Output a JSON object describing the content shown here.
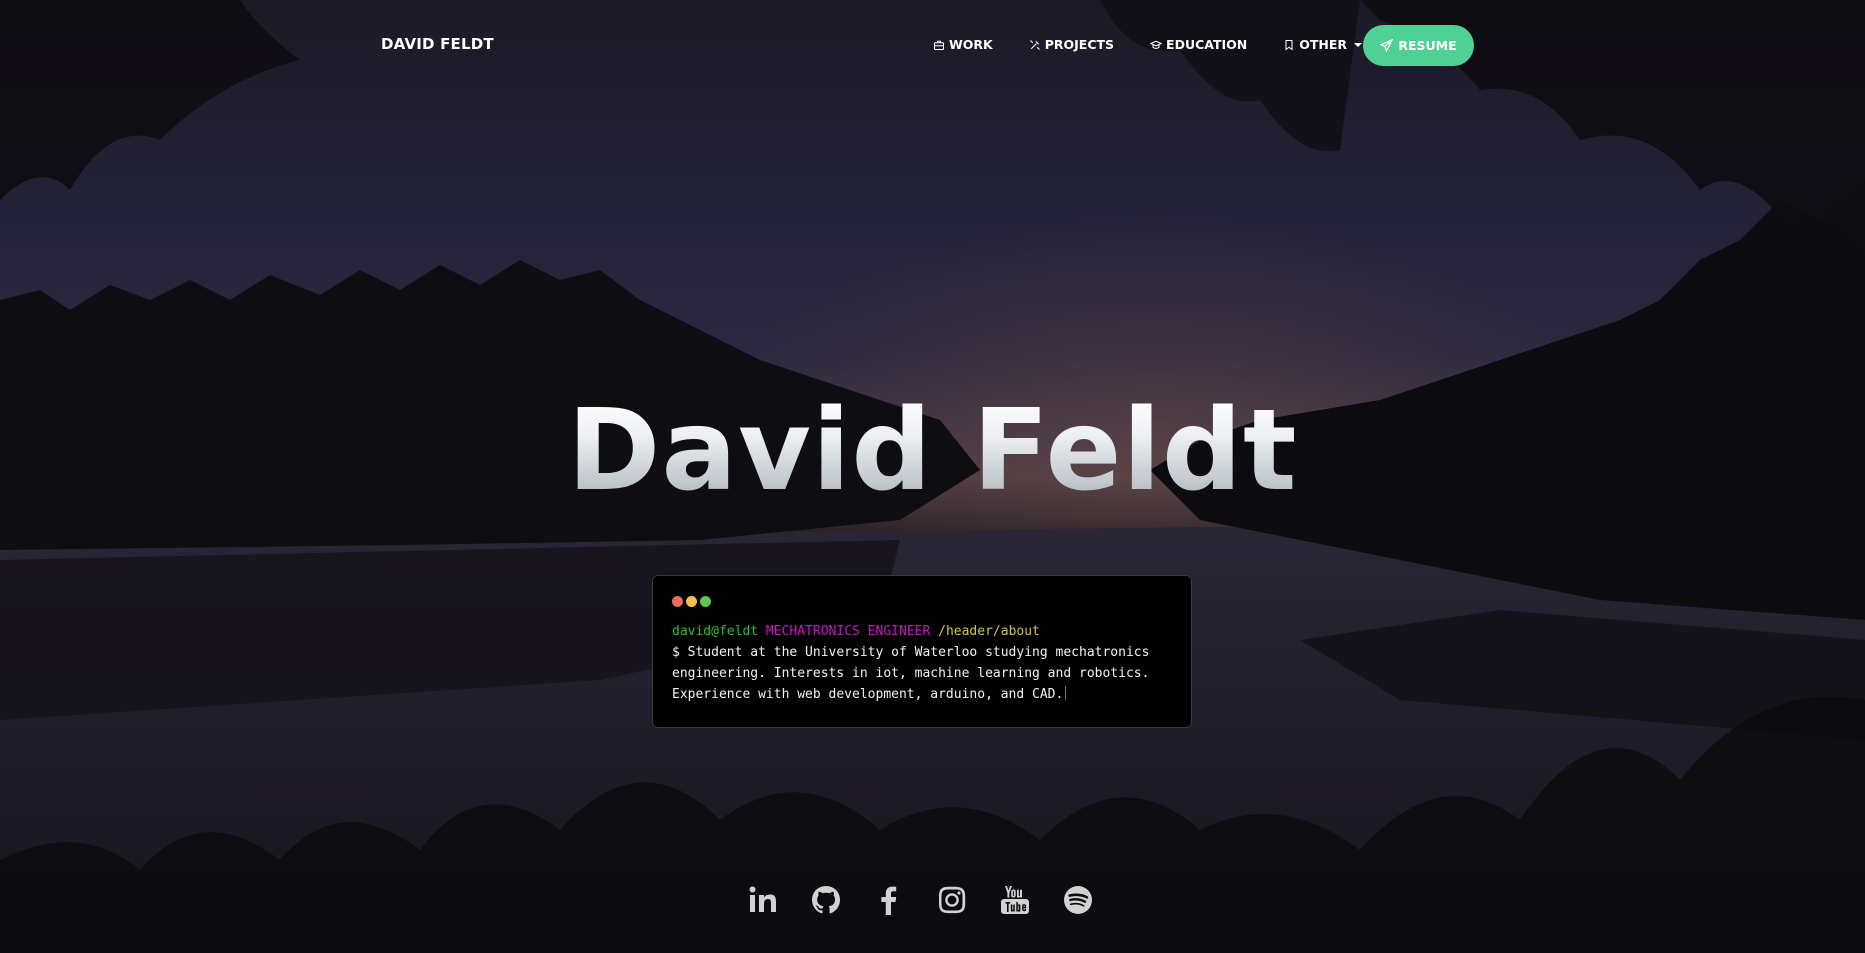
{
  "nav": {
    "brand": "DAVID FELDT",
    "links": [
      {
        "label": "WORK",
        "icon": "briefcase-icon"
      },
      {
        "label": "PROJECTS",
        "icon": "tools-icon"
      },
      {
        "label": "EDUCATION",
        "icon": "graduation-cap-icon"
      },
      {
        "label": "OTHER",
        "icon": "bookmark-icon"
      }
    ],
    "resume_label": "RESUME",
    "resume_icon": "paper-plane-icon",
    "accent_color": "#4fd195"
  },
  "hero": {
    "title": "David Feldt"
  },
  "terminal": {
    "user": "david@feldt",
    "role": "MECHATRONICS ENGINEER",
    "path": "/header/about",
    "line1": "$ Student at the University of Waterloo studying mechatronics",
    "line2": "engineering. Interests in iot, machine learning and robotics.",
    "line3": "Experience with web development, arduino, and CAD.",
    "dot_colors": [
      "#ec6a5e",
      "#f4bf4f",
      "#61c554"
    ]
  },
  "social": [
    {
      "name": "linkedin-icon"
    },
    {
      "name": "github-icon"
    },
    {
      "name": "facebook-icon"
    },
    {
      "name": "instagram-icon"
    },
    {
      "name": "youtube-icon"
    },
    {
      "name": "spotify-icon"
    }
  ]
}
